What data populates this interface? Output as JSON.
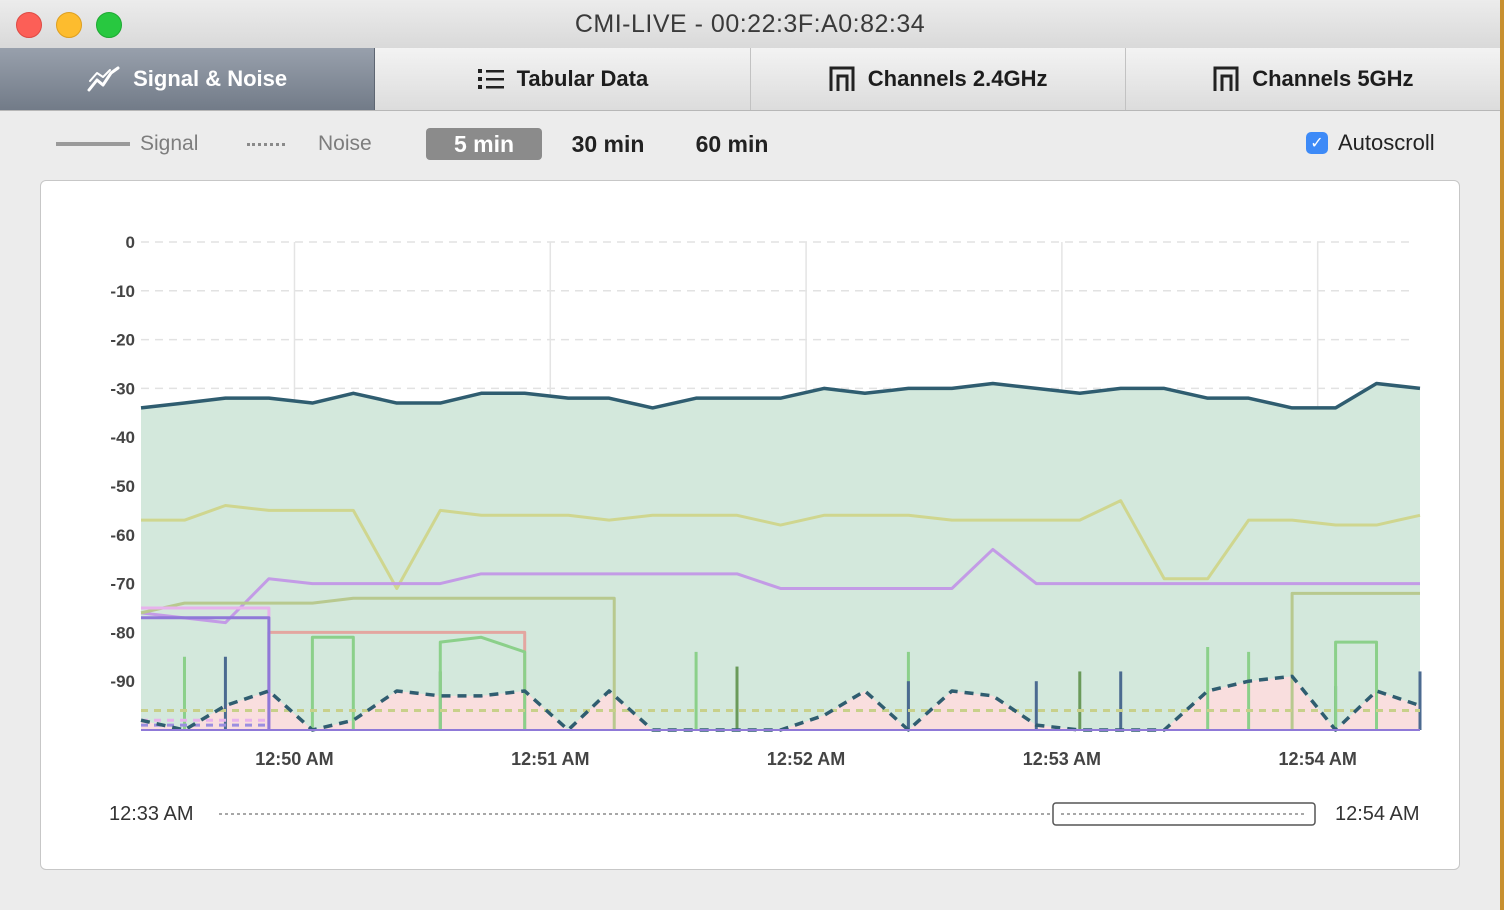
{
  "window": {
    "title": "CMI-LIVE - 00:22:3F:A0:82:34"
  },
  "tabs": [
    {
      "label": "Signal & Noise",
      "icon": "line-chart-icon",
      "active": true
    },
    {
      "label": "Tabular Data",
      "icon": "list-icon",
      "active": false
    },
    {
      "label": "Channels 2.4GHz",
      "icon": "channel-icon",
      "active": false
    },
    {
      "label": "Channels 5GHz",
      "icon": "channel-icon",
      "active": false
    }
  ],
  "legend": {
    "signal_label": "Signal",
    "noise_label": "Noise"
  },
  "time_buttons": [
    {
      "label": "5 min",
      "active": true
    },
    {
      "label": "30 min",
      "active": false
    },
    {
      "label": "60 min",
      "active": false
    }
  ],
  "autoscroll": {
    "label": "Autoscroll",
    "checked": true
  },
  "range": {
    "start": "12:33 AM",
    "end": "12:54 AM"
  },
  "colors": {
    "signal_fill": "#d3e8dc",
    "primary_signal": "#2f5d70",
    "noise_fill": "#f9dede",
    "accent_checkbox": "#3d8af7"
  },
  "chart_data": {
    "type": "line",
    "yticks": [
      "0",
      "-10",
      "-20",
      "-30",
      "-40",
      "-50",
      "-60",
      "-70",
      "-80",
      "-90"
    ],
    "ylim": [
      -100,
      0
    ],
    "xticks": [
      "12:50 AM",
      "12:51 AM",
      "12:52 AM",
      "12:53 AM",
      "12:54 AM"
    ],
    "x_minutes_range": [
      49.4,
      54.4
    ],
    "x_tick_minutes": [
      50,
      51,
      52,
      53,
      54
    ],
    "grid": true,
    "series": [
      {
        "color": "#2f5d70",
        "kind": "signal",
        "fill": true,
        "x": [
          49.4,
          49.57,
          49.73,
          49.9,
          50.07,
          50.23,
          50.4,
          50.57,
          50.73,
          50.9,
          51.07,
          51.23,
          51.4,
          51.57,
          51.73,
          51.9,
          52.07,
          52.23,
          52.4,
          52.57,
          52.73,
          52.9,
          53.07,
          53.23,
          53.4,
          53.57,
          53.73,
          53.9,
          54.07,
          54.23,
          54.4
        ],
        "y": [
          -34,
          -33,
          -32,
          -32,
          -33,
          -31,
          -33,
          -33,
          -31,
          -31,
          -32,
          -32,
          -34,
          -32,
          -32,
          -32,
          -30,
          -31,
          -30,
          -30,
          -29,
          -30,
          -31,
          -30,
          -30,
          -32,
          -32,
          -34,
          -34,
          -29,
          -30
        ]
      },
      {
        "color": "#cfd68f",
        "kind": "signal",
        "fill": false,
        "x": [
          49.4,
          49.57,
          49.73,
          49.9,
          50.23,
          50.4,
          50.57,
          50.73,
          50.9,
          51.07,
          51.23,
          51.4,
          51.57,
          51.73,
          51.9,
          52.07,
          52.23,
          52.4,
          52.57,
          52.73,
          52.9,
          53.07,
          53.23,
          53.4,
          53.57,
          53.73,
          53.9,
          54.07,
          54.23,
          54.4
        ],
        "y": [
          -57,
          -57,
          -54,
          -55,
          -55,
          -71,
          -55,
          -56,
          -56,
          -56,
          -57,
          -56,
          -56,
          -56,
          -58,
          -56,
          -56,
          -56,
          -57,
          -57,
          -57,
          -57,
          -53,
          -69,
          -69,
          -57,
          -57,
          -58,
          -58,
          -56
        ]
      },
      {
        "color": "#c39be6",
        "kind": "signal",
        "fill": false,
        "x": [
          49.4,
          49.73,
          49.9,
          50.07,
          50.23,
          50.57,
          50.73,
          50.9,
          51.07,
          51.4,
          51.73,
          51.9,
          52.07,
          52.23,
          52.57,
          52.73,
          52.9,
          53.07,
          53.4,
          53.73,
          54.07,
          54.4
        ],
        "y": [
          -76,
          -78,
          -69,
          -70,
          -70,
          -70,
          -68,
          -68,
          -68,
          -68,
          -68,
          -71,
          -71,
          -71,
          -71,
          -63,
          -70,
          -70,
          -70,
          -70,
          -70,
          -70
        ]
      },
      {
        "color": "#b8c98f",
        "kind": "signal",
        "fill": false,
        "x": [
          49.4,
          49.57,
          49.9,
          50.07,
          50.23,
          50.57,
          50.9,
          51.07,
          51.23,
          51.25,
          51.25
        ],
        "y": [
          -76,
          -74,
          -74,
          -74,
          -73,
          -73,
          -73,
          -73,
          -73,
          -73,
          -100
        ]
      },
      {
        "color": "#b8c98f",
        "kind": "signal",
        "fill": false,
        "x": [
          53.9,
          53.9,
          54.07,
          54.23,
          54.4
        ],
        "y": [
          -100,
          -72,
          -72,
          -72,
          -72
        ]
      },
      {
        "color": "#e3a6a0",
        "kind": "signal",
        "fill": false,
        "x": [
          49.9,
          49.9,
          50.9,
          50.9
        ],
        "y": [
          -100,
          -80,
          -80,
          -100
        ]
      },
      {
        "color": "#8bd08a",
        "kind": "signal",
        "fill": false,
        "x": [
          50.07,
          50.07,
          50.23,
          50.23
        ],
        "y": [
          -100,
          -81,
          -81,
          -100
        ]
      },
      {
        "color": "#8bd08a",
        "kind": "signal",
        "fill": false,
        "x": [
          50.57,
          50.57,
          50.73,
          50.9,
          50.9
        ],
        "y": [
          -100,
          -82,
          -81,
          -84,
          -100
        ]
      },
      {
        "color": "#8bd08a",
        "kind": "signal",
        "fill": false,
        "x": [
          54.07,
          54.07,
          54.23,
          54.23
        ],
        "y": [
          -100,
          -82,
          -82,
          -100
        ]
      },
      {
        "color": "#e7b2ec",
        "kind": "signal",
        "fill": false,
        "x": [
          49.4,
          49.9,
          49.9
        ],
        "y": [
          -75,
          -75,
          -100
        ]
      },
      {
        "color": "#8f79d8",
        "kind": "signal",
        "fill": false,
        "x": [
          49.4,
          49.9,
          49.9
        ],
        "y": [
          -77,
          -77,
          -100
        ]
      },
      {
        "color": "#2f5d70",
        "kind": "noise",
        "fill": true,
        "x": [
          49.4,
          49.57,
          49.73,
          49.9,
          50.07,
          50.23,
          50.4,
          50.57,
          50.73,
          50.9,
          51.07,
          51.23,
          51.4,
          51.57,
          51.73,
          51.9,
          52.07,
          52.23,
          52.4,
          52.57,
          52.73,
          52.9,
          53.07,
          53.23,
          53.4,
          53.57,
          53.73,
          53.9,
          54.07,
          54.23,
          54.4
        ],
        "y": [
          -98,
          -102,
          -95,
          -92,
          -101,
          -98,
          -92,
          -93,
          -93,
          -92,
          -100,
          -92,
          -101,
          -101,
          -101,
          -101,
          -97,
          -92,
          -101,
          -92,
          -93,
          -99,
          -100,
          -100,
          -100,
          -92,
          -90,
          -89,
          -100,
          -92,
          -95
        ]
      },
      {
        "color": "#e3a6a0",
        "kind": "noise",
        "fill": false,
        "x": [
          49.4,
          54.4
        ],
        "y": [
          -96,
          -96
        ]
      },
      {
        "color": "#c8d08a",
        "kind": "noise",
        "fill": false,
        "x": [
          49.4,
          54.4
        ],
        "y": [
          -96,
          -96
        ]
      },
      {
        "color": "#e7b2ec",
        "kind": "noise",
        "fill": false,
        "x": [
          49.4,
          49.9
        ],
        "y": [
          -98,
          -98
        ]
      },
      {
        "color": "#9b8ee0",
        "kind": "noise",
        "fill": false,
        "x": [
          49.4,
          49.9
        ],
        "y": [
          -99,
          -99
        ]
      }
    ],
    "spikes": [
      {
        "x": 49.57,
        "y": -85,
        "color": "#8bd08a"
      },
      {
        "x": 49.73,
        "y": -85,
        "color": "#4b6a90"
      },
      {
        "x": 50.57,
        "y": -88,
        "color": "#7a9c6a"
      },
      {
        "x": 51.57,
        "y": -84,
        "color": "#8bd08a"
      },
      {
        "x": 51.73,
        "y": -87,
        "color": "#6a9a5a"
      },
      {
        "x": 52.4,
        "y": -84,
        "color": "#8bd08a"
      },
      {
        "x": 52.4,
        "y": -90,
        "color": "#4b6a90"
      },
      {
        "x": 52.9,
        "y": -90,
        "color": "#4b6a90"
      },
      {
        "x": 53.07,
        "y": -88,
        "color": "#6a9a5a"
      },
      {
        "x": 53.23,
        "y": -88,
        "color": "#4b6a90"
      },
      {
        "x": 53.57,
        "y": -83,
        "color": "#8bd08a"
      },
      {
        "x": 53.73,
        "y": -84,
        "color": "#8bd08a"
      },
      {
        "x": 54.07,
        "y": -91,
        "color": "#4b6a90"
      },
      {
        "x": 54.4,
        "y": -88,
        "color": "#4b6a90"
      }
    ]
  }
}
